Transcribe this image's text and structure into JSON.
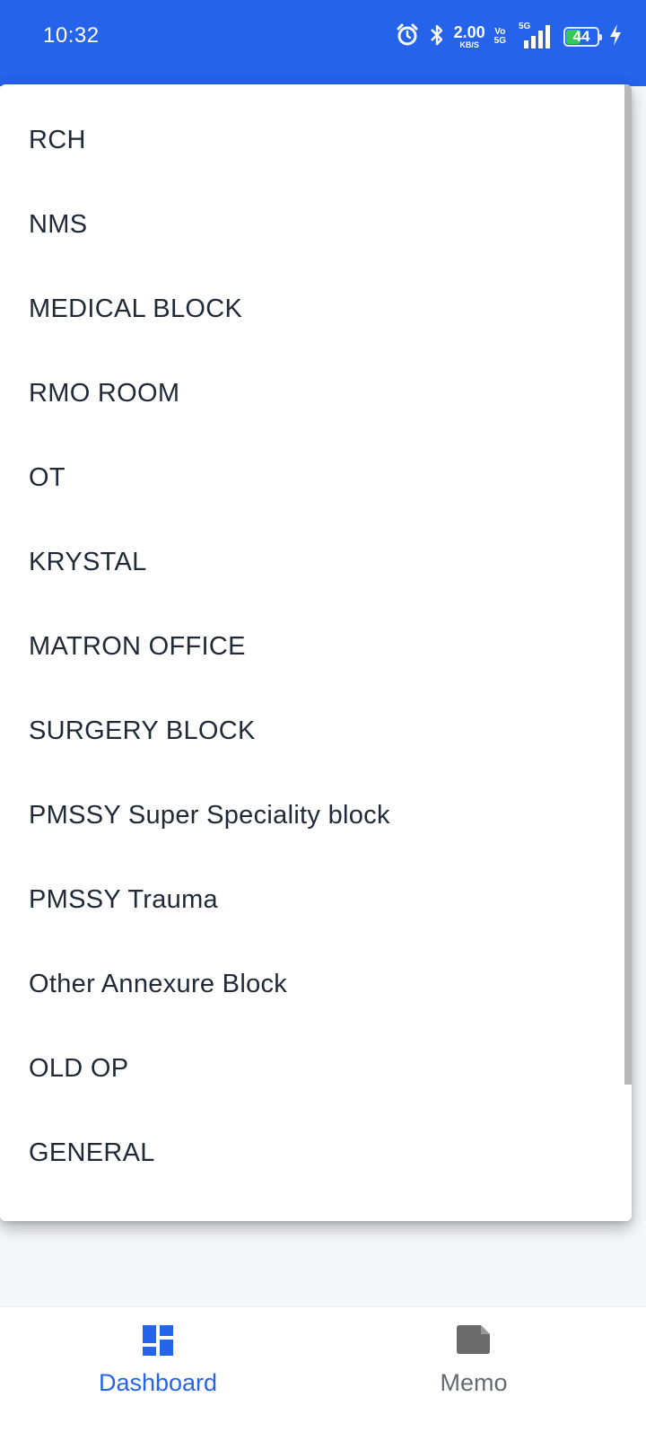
{
  "status_bar": {
    "time": "10:32",
    "net_speed_value": "2.00",
    "net_speed_unit": "KB/S",
    "volte_top": "Vo",
    "volte_bottom": "5G",
    "signal_label": "5G",
    "battery_level": "44",
    "battery_fill_percent": 44,
    "icons": [
      "alarm-icon",
      "bluetooth-icon",
      "signal-icon",
      "battery-icon",
      "charging-icon"
    ],
    "colors": {
      "background": "#2563eb",
      "battery_fill": "#34c759"
    }
  },
  "dropdown": {
    "items": [
      {
        "label": "RCH"
      },
      {
        "label": "NMS"
      },
      {
        "label": "MEDICAL BLOCK"
      },
      {
        "label": "RMO ROOM"
      },
      {
        "label": "OT"
      },
      {
        "label": "KRYSTAL"
      },
      {
        "label": "MATRON OFFICE"
      },
      {
        "label": "SURGERY BLOCK"
      },
      {
        "label": "PMSSY Super Speciality block"
      },
      {
        "label": "PMSSY Trauma"
      },
      {
        "label": "Other Annexure Block"
      },
      {
        "label": "OLD OP"
      },
      {
        "label": "GENERAL"
      }
    ]
  },
  "bottom_nav": {
    "items": [
      {
        "label": "Dashboard",
        "icon": "dashboard-icon",
        "active": true
      },
      {
        "label": "Memo",
        "icon": "memo-icon",
        "active": false
      }
    ],
    "colors": {
      "active": "#2563eb",
      "inactive": "#666a70"
    }
  }
}
